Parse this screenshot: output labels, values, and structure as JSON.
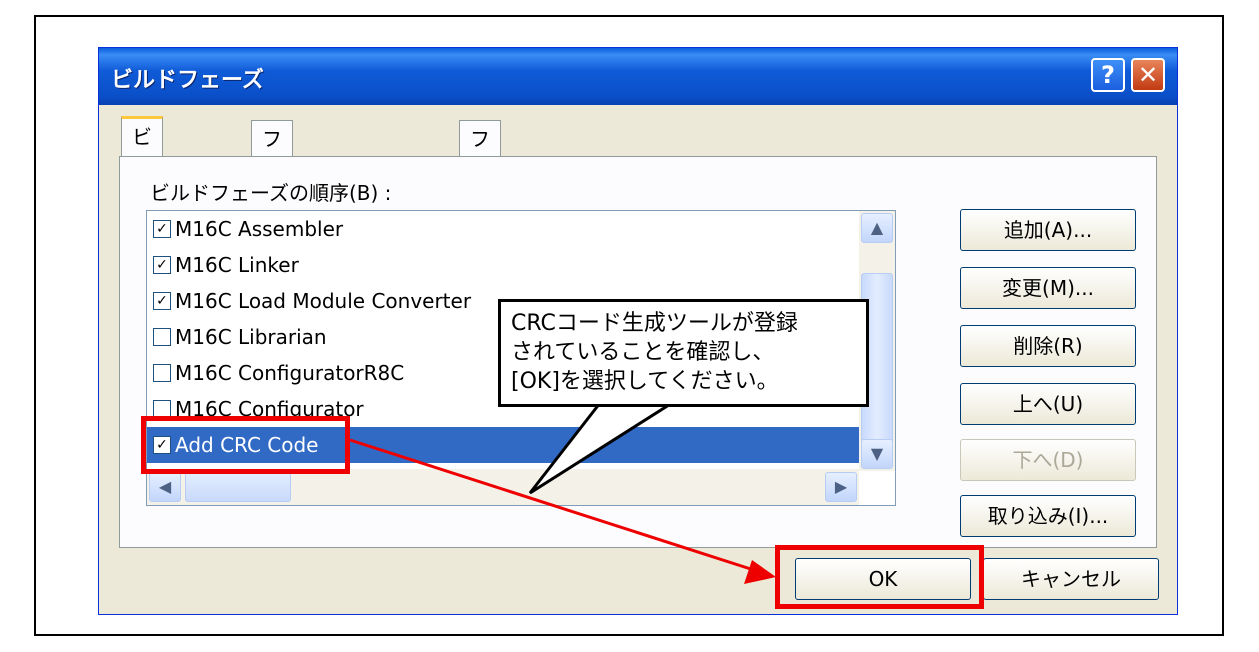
{
  "dialog": {
    "title": "ビルドフェーズ",
    "help_button": "?",
    "close_button": "✕"
  },
  "tabs": [
    {
      "label": "ビルド順序",
      "active": true
    },
    {
      "label": "ファイルのビルド順序",
      "active": false
    },
    {
      "label": "ファイルマッピング",
      "active": false
    }
  ],
  "group_label": "ビルドフェーズの順序(B) :",
  "build_phases": [
    {
      "label": "M16C Assembler",
      "checked": true
    },
    {
      "label": "M16C Linker",
      "checked": true
    },
    {
      "label": "M16C Load Module Converter",
      "checked": true
    },
    {
      "label": "M16C Librarian",
      "checked": false
    },
    {
      "label": "M16C ConfiguratorR8C",
      "checked": false
    },
    {
      "label": "M16C Configurator",
      "checked": false
    },
    {
      "label": "Add CRC Code",
      "checked": true,
      "selected": true
    }
  ],
  "side_buttons": {
    "add": "追加(A)...",
    "change": "変更(M)...",
    "delete": "削除(R)",
    "up": "上へ(U)",
    "down": "下へ(D)",
    "import": "取り込み(I)..."
  },
  "bottom_buttons": {
    "ok": "OK",
    "cancel": "キャンセル"
  },
  "callout": {
    "line1": "CRCコード生成ツールが登録",
    "line2": "されていることを確認し、",
    "line3": "[OK]を選択してください。"
  },
  "colors": {
    "titlebar": "#0a4fc8",
    "selection": "#316ac5",
    "highlight_box": "#ee0000"
  },
  "icons": {
    "scroll_up": "▲",
    "scroll_down": "▼",
    "scroll_left": "◀",
    "scroll_right": "▶"
  }
}
